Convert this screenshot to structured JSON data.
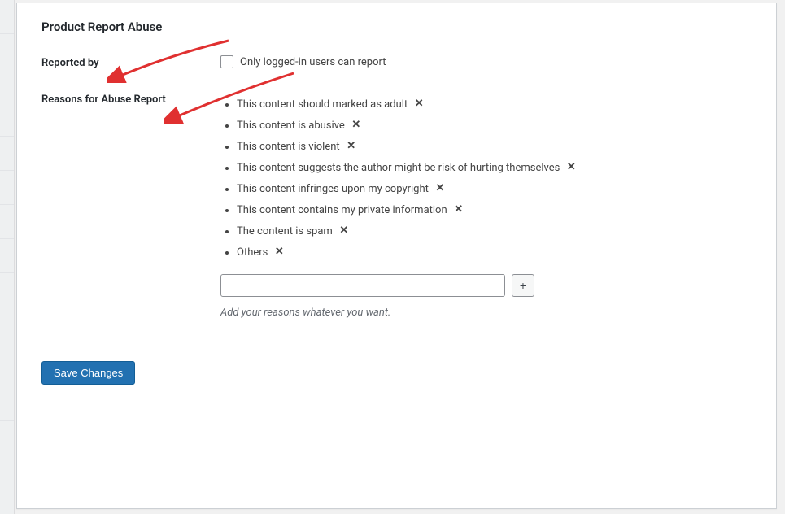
{
  "section": {
    "title": "Product Report Abuse",
    "reported_by_label": "Reported by",
    "only_logged_in_label": "Only logged-in users can report",
    "reasons_label": "Reasons for Abuse Report",
    "reasons": [
      "This content should marked as adult",
      "This content is abusive",
      "This content is violent",
      "This content suggests the author might be risk of hurting themselves",
      "This content infringes upon my copyright",
      "This content contains my private information",
      "The content is spam",
      "Others"
    ],
    "add_reason_placeholder": "",
    "add_reason_helper": "Add your reasons whatever you want.",
    "save_button_label": "Save Changes"
  },
  "icons": {
    "remove_glyph": "✕",
    "plus_glyph": "+"
  }
}
